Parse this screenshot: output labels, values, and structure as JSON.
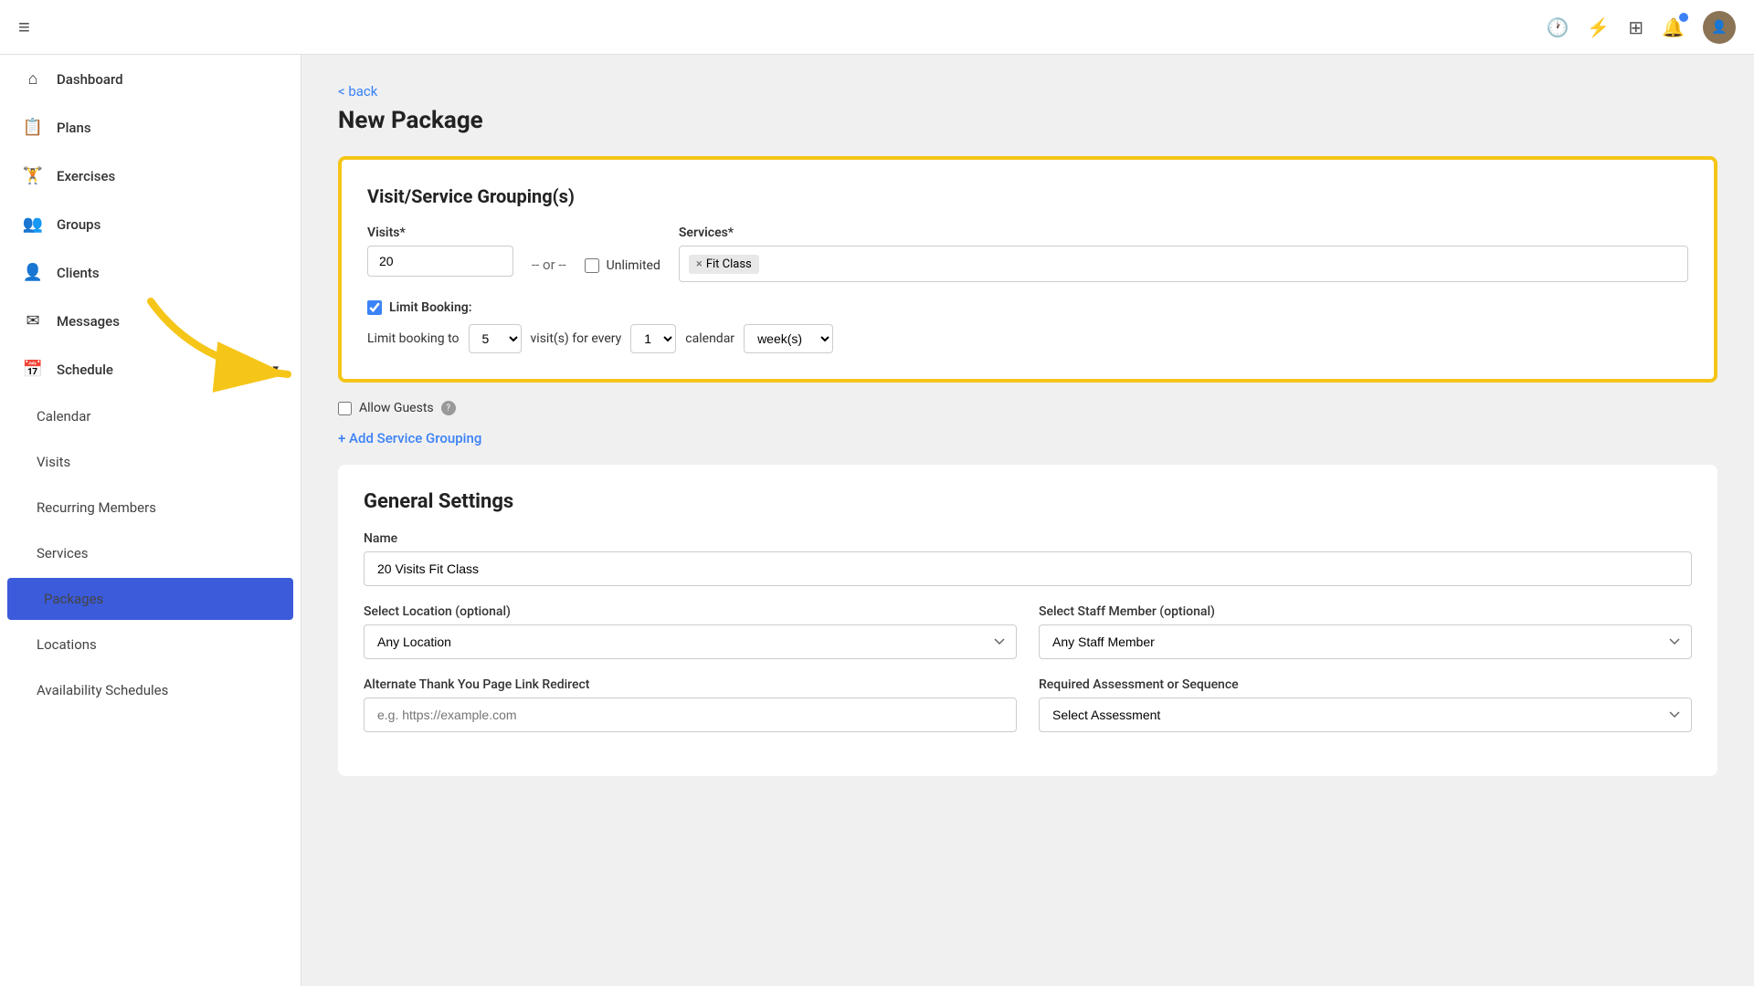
{
  "topnav": {
    "hamburger": "≡",
    "icons": [
      "🕐",
      "⚡",
      "⊞",
      "🔔"
    ],
    "avatar_text": "👤"
  },
  "sidebar": {
    "items": [
      {
        "id": "dashboard",
        "label": "Dashboard",
        "icon": "⌂",
        "active": false
      },
      {
        "id": "plans",
        "label": "Plans",
        "icon": "📋",
        "active": false
      },
      {
        "id": "exercises",
        "label": "Exercises",
        "icon": "🏋",
        "active": false
      },
      {
        "id": "groups",
        "label": "Groups",
        "icon": "👥",
        "active": false
      },
      {
        "id": "clients",
        "label": "Clients",
        "icon": "👤",
        "active": false
      },
      {
        "id": "messages",
        "label": "Messages",
        "icon": "✉",
        "active": false
      },
      {
        "id": "schedule",
        "label": "Schedule",
        "icon": "📅",
        "active": false,
        "has_arrow": true
      },
      {
        "id": "calendar",
        "label": "Calendar",
        "icon": "",
        "active": false,
        "sub": true
      },
      {
        "id": "visits",
        "label": "Visits",
        "icon": "",
        "active": false,
        "sub": true
      },
      {
        "id": "recurring-members",
        "label": "Recurring Members",
        "icon": "",
        "active": false,
        "sub": true
      },
      {
        "id": "services",
        "label": "Services",
        "icon": "",
        "active": false,
        "sub": true
      },
      {
        "id": "packages",
        "label": "Packages",
        "icon": "",
        "active": true,
        "sub": true
      },
      {
        "id": "locations",
        "label": "Locations",
        "icon": "",
        "active": false,
        "sub": true
      },
      {
        "id": "availability-schedules",
        "label": "Availability Schedules",
        "icon": "",
        "active": false,
        "sub": true
      }
    ]
  },
  "back_link": "< back",
  "page_title": "New Package",
  "grouping_card": {
    "title": "Visit/Service Grouping(s)",
    "visits_label": "Visits*",
    "visits_value": "20",
    "or_text": "-- or --",
    "unlimited_label": "Unlimited",
    "services_label": "Services*",
    "service_tag": "Fit Class",
    "limit_booking_label": "Limit Booking:",
    "limit_text_1": "Limit booking to",
    "limit_value_1": "5",
    "limit_text_2": "visit(s) for every",
    "limit_value_2": "1",
    "limit_text_3": "calendar",
    "limit_value_3": "week(s)"
  },
  "allow_guests_label": "Allow Guests",
  "add_grouping_label": "+ Add Service Grouping",
  "general_settings": {
    "title": "General Settings",
    "name_label": "Name",
    "name_value": "20 Visits Fit Class",
    "location_label": "Select Location (optional)",
    "location_placeholder": "Any Location",
    "staff_label": "Select Staff Member (optional)",
    "staff_placeholder": "Any Staff Member",
    "thankyou_label": "Alternate Thank You Page Link Redirect",
    "thankyou_placeholder": "e.g. https://example.com",
    "assessment_label": "Required Assessment or Sequence",
    "assessment_placeholder": "Select Assessment"
  }
}
